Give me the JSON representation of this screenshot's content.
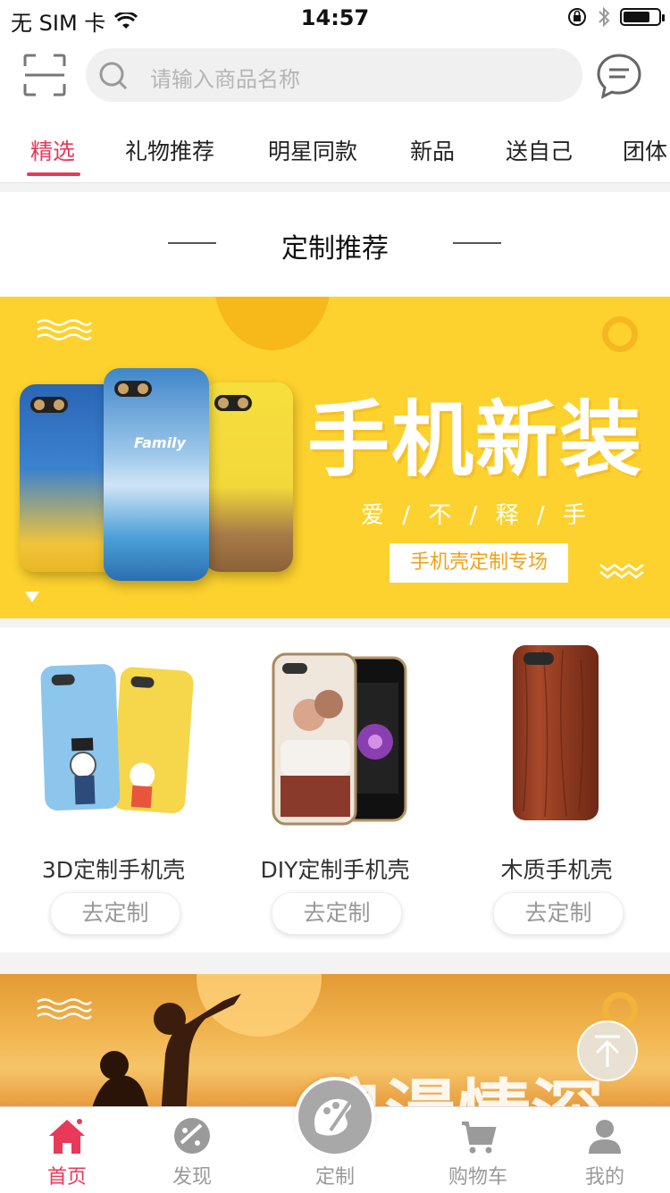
{
  "status_bar": {
    "carrier": "无 SIM 卡",
    "time": "14:57",
    "battery_level": 0.75
  },
  "header": {
    "search_placeholder": "请输入商品名称",
    "icons": [
      "scan-icon",
      "search-icon",
      "message-icon"
    ]
  },
  "tabs": [
    {
      "label": "精选",
      "active": true
    },
    {
      "label": "礼物推荐",
      "active": false
    },
    {
      "label": "明星同款",
      "active": false
    },
    {
      "label": "新品",
      "active": false
    },
    {
      "label": "送自己",
      "active": false
    },
    {
      "label": "团体",
      "active": false
    }
  ],
  "section_title": "定制推荐",
  "banner": {
    "phone_text": "Family",
    "headline": "手机新装",
    "subtitle": "爱 / 不 / 释 / 手",
    "tag": "手机壳定制专场",
    "bg_color": "#fdd22e"
  },
  "products": [
    {
      "name": "3D定制手机壳",
      "button": "去定制"
    },
    {
      "name": "DIY定制手机壳",
      "button": "去定制"
    },
    {
      "name": "木质手机壳",
      "button": "去定制"
    }
  ],
  "banner2": {
    "headline": "浪漫情深"
  },
  "bottom_nav": [
    {
      "label": "首页",
      "icon": "home-icon",
      "active": true
    },
    {
      "label": "发现",
      "icon": "palette-icon",
      "active": false
    },
    {
      "label": "定制",
      "icon": "brush-icon",
      "active": false
    },
    {
      "label": "购物车",
      "icon": "cart-icon",
      "active": false
    },
    {
      "label": "我的",
      "icon": "user-icon",
      "active": false
    }
  ],
  "colors": {
    "accent": "#e8395a",
    "nav_inactive": "#9a9a9a"
  }
}
